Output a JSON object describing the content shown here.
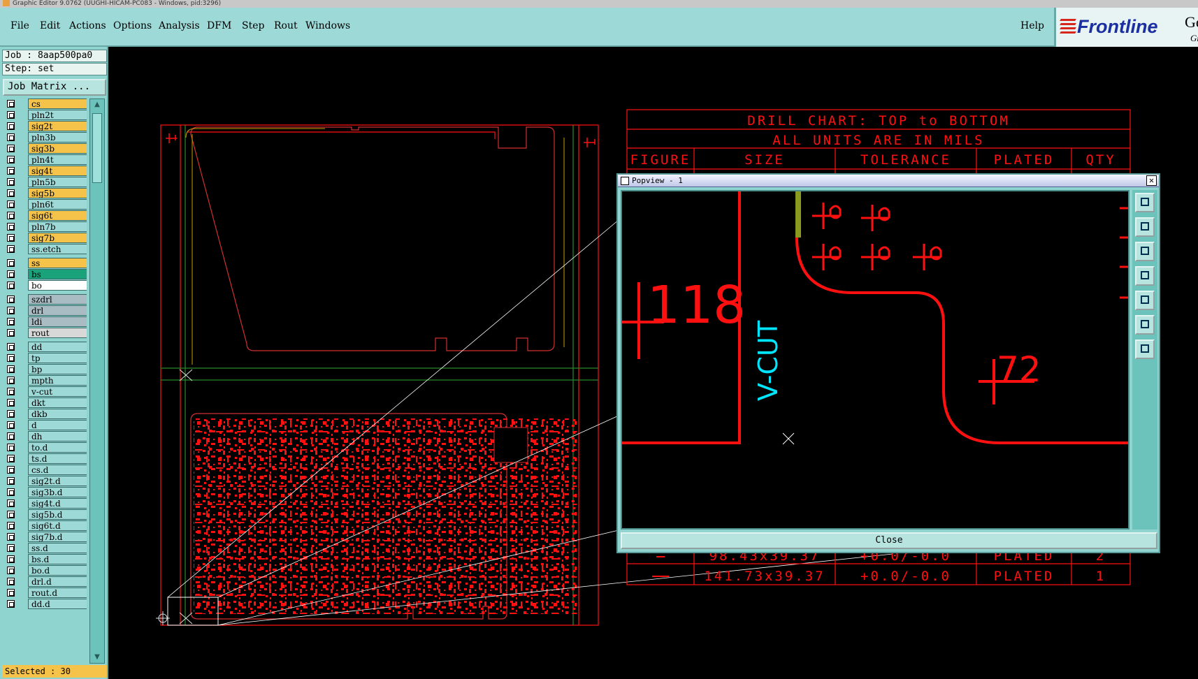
{
  "window": {
    "title": "Graphic Editor 9.0762 (UUGHI-HICAM-PC083 - Windows, pid:3296)"
  },
  "menu": {
    "file": "File",
    "edit": "Edit",
    "actions": "Actions",
    "options": "Options",
    "analysis": "Analysis",
    "dfm": "DFM",
    "step": "Step",
    "rout": "Rout",
    "windows": "Windows",
    "help": "Help"
  },
  "logo": {
    "brand": "Frontline",
    "product": "Ger",
    "sub": "Gr"
  },
  "job": {
    "job_label": "Job : 8aap500pa0",
    "step_label": "Step: set",
    "matrix_button": "Job Matrix ..."
  },
  "layers": [
    {
      "name": "cs",
      "color": "#f5c24a"
    },
    {
      "name": "pln2t",
      "color": "#9dd9d6"
    },
    {
      "name": "sig2t",
      "color": "#f5c24a"
    },
    {
      "name": "pln3b",
      "color": "#9dd9d6"
    },
    {
      "name": "sig3b",
      "color": "#f5c24a"
    },
    {
      "name": "pln4t",
      "color": "#9dd9d6"
    },
    {
      "name": "sig4t",
      "color": "#f5c24a"
    },
    {
      "name": "pln5b",
      "color": "#9dd9d6"
    },
    {
      "name": "sig5b",
      "color": "#f5c24a"
    },
    {
      "name": "pln6t",
      "color": "#9dd9d6"
    },
    {
      "name": "sig6t",
      "color": "#f5c24a"
    },
    {
      "name": "pln7b",
      "color": "#9dd9d6"
    },
    {
      "name": "sig7b",
      "color": "#f5c24a"
    },
    {
      "name": "ss.etch",
      "color": "#9dd9d6"
    },
    {
      "name": "ss",
      "color": "#f5c24a"
    },
    {
      "name": "bs",
      "color": "#1aa37a"
    },
    {
      "name": "bo",
      "color": "#ffffff"
    },
    {
      "name": "szdrl",
      "color": "#a9bcc4"
    },
    {
      "name": "drl",
      "color": "#a9bcc4"
    },
    {
      "name": "ldi",
      "color": "#a9bcc4"
    },
    {
      "name": "rout",
      "color": "#d8d8d8"
    },
    {
      "name": "dd",
      "color": "#9dd9d6"
    },
    {
      "name": "tp",
      "color": "#9dd9d6"
    },
    {
      "name": "bp",
      "color": "#9dd9d6"
    },
    {
      "name": "mpth",
      "color": "#9dd9d6"
    },
    {
      "name": "v-cut",
      "color": "#9dd9d6"
    },
    {
      "name": "dkt",
      "color": "#9dd9d6"
    },
    {
      "name": "dkb",
      "color": "#9dd9d6"
    },
    {
      "name": "d",
      "color": "#9dd9d6"
    },
    {
      "name": "dh",
      "color": "#9dd9d6"
    },
    {
      "name": "to.d",
      "color": "#9dd9d6"
    },
    {
      "name": "ts.d",
      "color": "#9dd9d6"
    },
    {
      "name": "cs.d",
      "color": "#9dd9d6"
    },
    {
      "name": "sig2t.d",
      "color": "#9dd9d6"
    },
    {
      "name": "sig3b.d",
      "color": "#9dd9d6"
    },
    {
      "name": "sig4t.d",
      "color": "#9dd9d6"
    },
    {
      "name": "sig5b.d",
      "color": "#9dd9d6"
    },
    {
      "name": "sig6t.d",
      "color": "#9dd9d6"
    },
    {
      "name": "sig7b.d",
      "color": "#9dd9d6"
    },
    {
      "name": "ss.d",
      "color": "#9dd9d6"
    },
    {
      "name": "bs.d",
      "color": "#9dd9d6"
    },
    {
      "name": "bo.d",
      "color": "#9dd9d6"
    },
    {
      "name": "drl.d",
      "color": "#9dd9d6"
    },
    {
      "name": "rout.d",
      "color": "#9dd9d6"
    },
    {
      "name": "dd.d",
      "color": "#9dd9d6"
    }
  ],
  "status": {
    "selected": "Selected : 30"
  },
  "drill_chart": {
    "title": "DRILL CHART: TOP to BOTTOM",
    "units": "ALL UNITS ARE IN MILS",
    "headers": [
      "FIGURE",
      "SIZE",
      "TOLERANCE",
      "PLATED",
      "QTY"
    ],
    "rows": [
      [
        "",
        "98.43x39.37",
        "+0.0/-0.0",
        "PLATED",
        "2"
      ],
      [
        "",
        "141.73x39.37",
        "+0.0/-0.0",
        "PLATED",
        "1"
      ]
    ]
  },
  "popview": {
    "title": "Popview - 1",
    "close_label": "Close",
    "labels": {
      "n118": "118",
      "n72": "72",
      "vcut": "V-CUT"
    }
  },
  "colors": {
    "feature": "#ff1010",
    "outline": "#c8a000",
    "vcut": "#00e5ff",
    "panel": "#9dd9d6"
  }
}
